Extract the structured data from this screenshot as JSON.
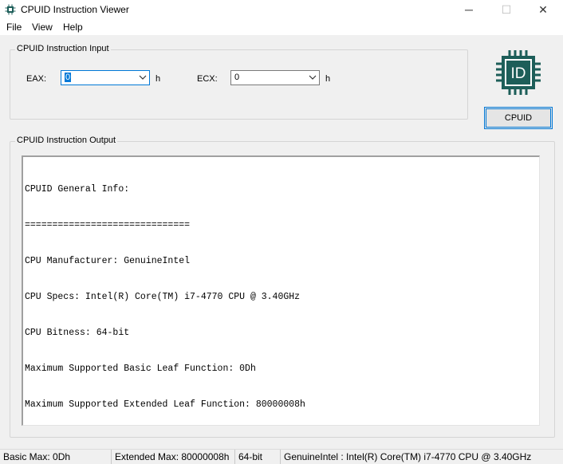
{
  "window": {
    "title": "CPUID Instruction Viewer",
    "controls": {
      "minimize": "─",
      "maximize": "☐",
      "close": "✕"
    }
  },
  "menu": {
    "items": [
      "File",
      "View",
      "Help"
    ]
  },
  "input_group": {
    "legend": "CPUID Instruction Input",
    "eax": {
      "label": "EAX:",
      "value": "0",
      "unit": "h"
    },
    "ecx": {
      "label": "ECX:",
      "value": "0",
      "unit": "h"
    }
  },
  "logo": {
    "text": "ID",
    "icon": "chip-icon",
    "color": "#1d5e59"
  },
  "cpuid_button": {
    "label": "CPUID"
  },
  "output_group": {
    "legend": "CPUID Instruction Output",
    "lines": [
      "CPUID General Info:",
      "==============================",
      "CPU Manufacturer: GenuineIntel",
      "CPU Specs: Intel(R) Core(TM) i7-4770 CPU @ 3.40GHz",
      "CPU Bitness: 64-bit",
      "Maximum Supported Basic Leaf Function: 0Dh",
      "Maximum Supported Extended Leaf Function: 80000008h"
    ]
  },
  "status": {
    "basic_max": "Basic Max: 0Dh",
    "extended_max": "Extended Max: 80000008h",
    "bitness": "64-bit",
    "cpu": "GenuineIntel : Intel(R) Core(TM) i7-4770 CPU @ 3.40GHz"
  },
  "colors": {
    "accent": "#0078d7",
    "brand": "#1d5e59"
  }
}
